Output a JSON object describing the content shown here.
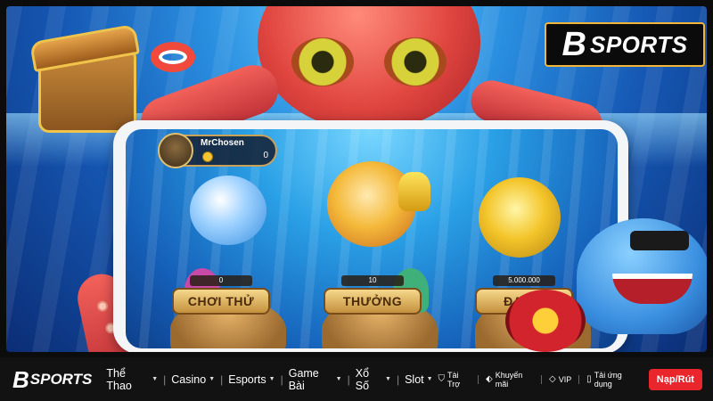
{
  "banner": {
    "logo": {
      "mark": "B",
      "text": "SPORTS"
    },
    "phone": {
      "player": {
        "name": "MrChosen",
        "coins": "0"
      },
      "modes": [
        {
          "label": "CHƠI THỬ",
          "value": "0"
        },
        {
          "label": "THƯỞNG",
          "value": "10"
        },
        {
          "label": "ĐẠI GI",
          "value": "5.000.000"
        }
      ]
    }
  },
  "nav": {
    "logo": {
      "mark": "B",
      "text": "SPORTS"
    },
    "menu": [
      {
        "label": "Thể Thao"
      },
      {
        "label": "Casino"
      },
      {
        "label": "Esports"
      },
      {
        "label": "Game Bài"
      },
      {
        "label": "Xổ Số"
      },
      {
        "label": "Slot"
      }
    ],
    "links": [
      {
        "label": "Tài Trợ",
        "icon": "shield-icon"
      },
      {
        "label": "Khuyến mãi",
        "icon": "tag-icon"
      },
      {
        "label": "VIP",
        "icon": "diamond-icon"
      },
      {
        "label": "Tải ứng dụng",
        "icon": "phone-icon"
      }
    ],
    "cta": "Nạp/Rút"
  }
}
